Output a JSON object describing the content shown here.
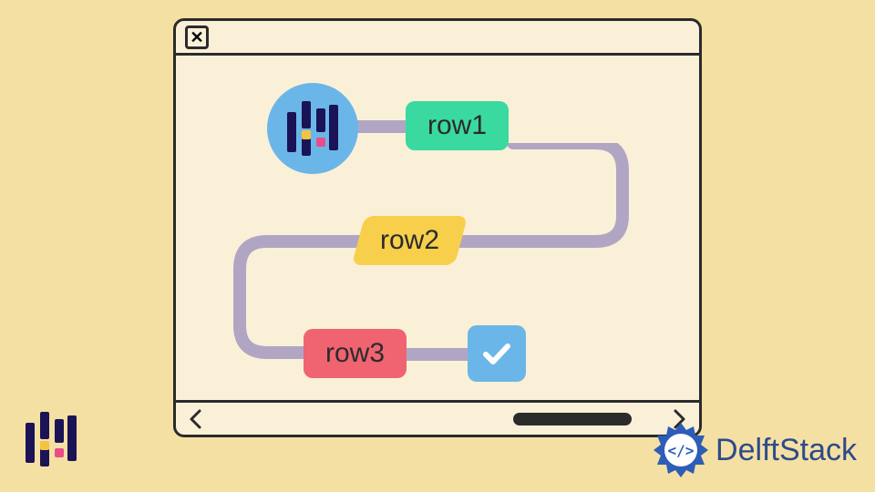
{
  "window": {
    "close_glyph": "✕"
  },
  "flow": {
    "node1_label": "row1",
    "node2_label": "row2",
    "node3_label": "row3"
  },
  "brand": {
    "name": "DelftStack"
  },
  "colors": {
    "bg": "#f5e0a3",
    "window_bg": "#faf0d8",
    "outline": "#2b2b2b",
    "circle": "#6bb6e8",
    "row1": "#3ad9a0",
    "row2": "#f7cf4a",
    "row3": "#ef6470",
    "connector": "#b0a6c4",
    "brand_text": "#2d4a8a",
    "logo_dark": "#1a1456"
  }
}
